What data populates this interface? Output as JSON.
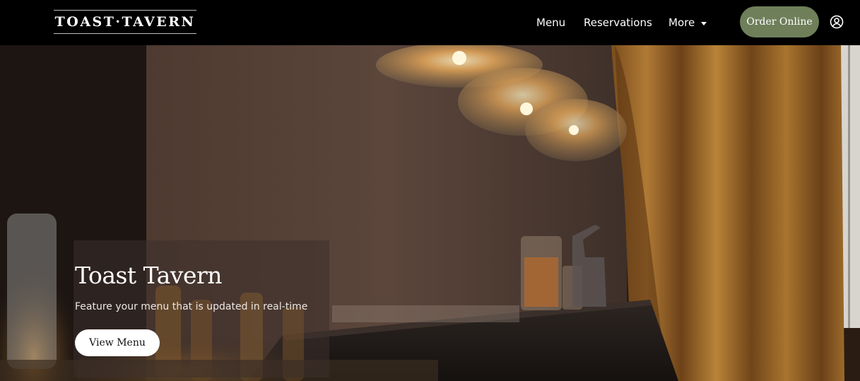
{
  "header": {
    "logo_text": "TOAST·TAVERN",
    "nav": {
      "menu": "Menu",
      "reservations": "Reservations",
      "more": "More"
    },
    "order_online": "Order Online",
    "account_icon": "user-circle-icon",
    "order_button_color": "#6f7f5a"
  },
  "hero": {
    "title": "Toast Tavern",
    "subtitle": "Feature your menu that is updated in real-time",
    "cta": "View Menu"
  }
}
